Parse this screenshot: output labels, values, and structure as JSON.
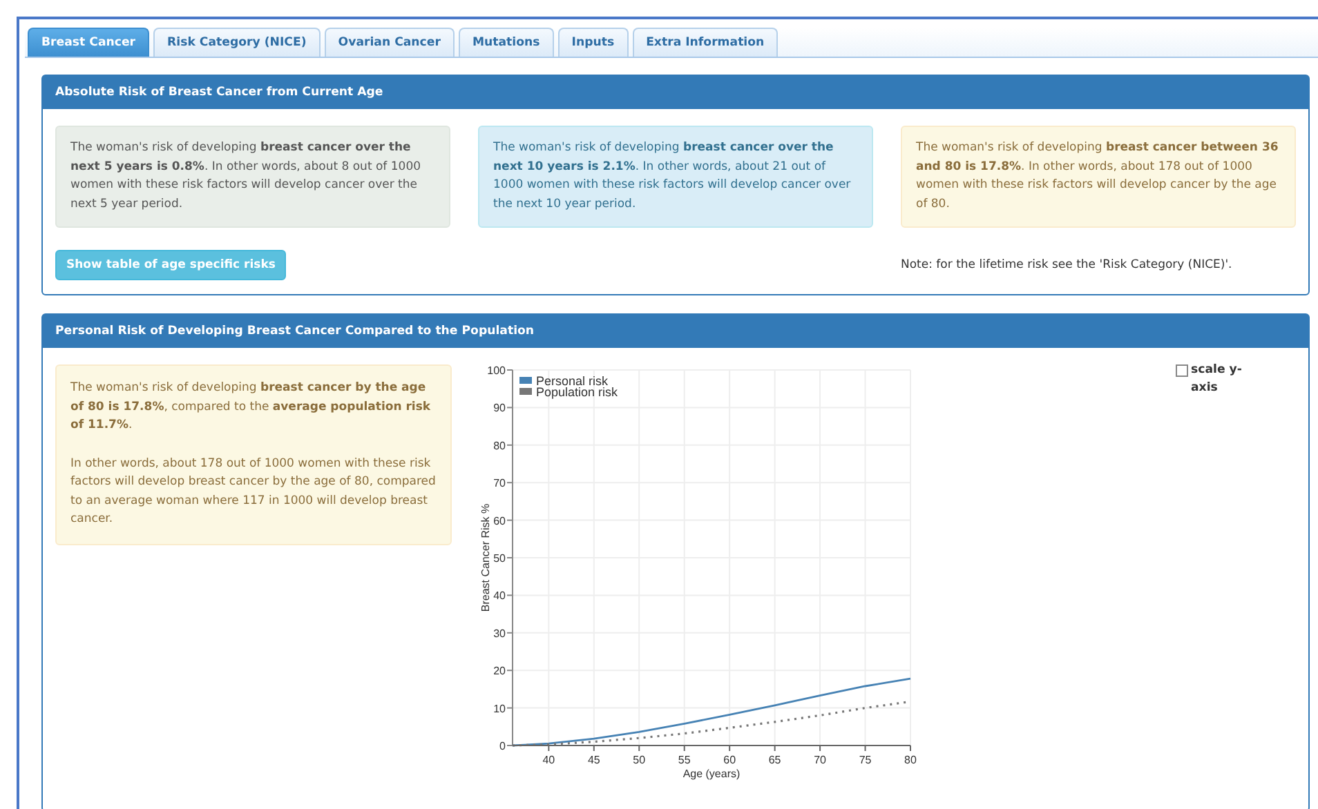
{
  "tabs": [
    {
      "label": "Breast Cancer",
      "selected": true
    },
    {
      "label": "Risk Category (NICE)",
      "selected": false
    },
    {
      "label": "Ovarian Cancer",
      "selected": false
    },
    {
      "label": "Mutations",
      "selected": false
    },
    {
      "label": "Inputs",
      "selected": false
    },
    {
      "label": "Extra Information",
      "selected": false
    }
  ],
  "absolute_risk": {
    "title": "Absolute Risk of Breast Cancer from Current Age",
    "boxes": [
      {
        "kind": "neutral",
        "text": "The woman's risk of developing **breast cancer over the next 5 years is 0.8%**. In other words, about 8 out of 1000 women with these risk factors will develop cancer over the next 5 year period."
      },
      {
        "kind": "info",
        "text": "The woman's risk of developing **breast cancer over the next 10 years is 2.1%**. In other words, about 21 out of 1000 women with these risk factors will develop cancer over the next 10 year period."
      },
      {
        "kind": "warning",
        "text": "The woman's risk of developing **breast cancer between 36 and 80 is 17.8%**. In other words, about 178 out of 1000 women with these risk factors will develop cancer by the age of 80."
      }
    ],
    "button": "Show table of age specific risks",
    "note": "Note: for the lifetime risk see the 'Risk Category (NICE)'."
  },
  "personal_risk": {
    "title": "Personal Risk of Developing Breast Cancer Compared to the Population",
    "paragraphs": [
      "The woman's risk of developing **breast cancer by the age of 80 is 17.8%**, compared to the **average population risk of 11.7%**.",
      "In other words, about 178 out of 1000 women with these risk factors will develop breast cancer by the age of 80, compared to an average woman where 117 in 1000 will develop breast cancer."
    ],
    "scale_checkbox": {
      "label": "scale y-axis",
      "checked": false
    },
    "chart_data": {
      "type": "line",
      "xlabel": "Age (years)",
      "ylabel": "Breast Cancer Risk %",
      "x": [
        36,
        40,
        45,
        50,
        55,
        60,
        65,
        70,
        75,
        80
      ],
      "series": [
        {
          "name": "Personal risk",
          "color": "#4682b4",
          "line_style": "solid",
          "values": [
            0,
            0.5,
            1.8,
            3.6,
            5.8,
            8.2,
            10.7,
            13.3,
            15.8,
            17.8
          ]
        },
        {
          "name": "Population risk",
          "color": "#777777",
          "line_style": "dotted",
          "values": [
            0,
            0.3,
            1,
            2,
            3.2,
            4.7,
            6.3,
            8,
            10,
            11.7
          ]
        }
      ],
      "grid": true,
      "legend": true,
      "xlim": [
        36,
        80
      ],
      "ylim": [
        0,
        100
      ],
      "xticks": [
        40,
        45,
        50,
        55,
        60,
        65,
        70,
        75,
        80
      ],
      "yticks": [
        0,
        10,
        20,
        30,
        40,
        50,
        60,
        70,
        80,
        90,
        100
      ]
    }
  }
}
